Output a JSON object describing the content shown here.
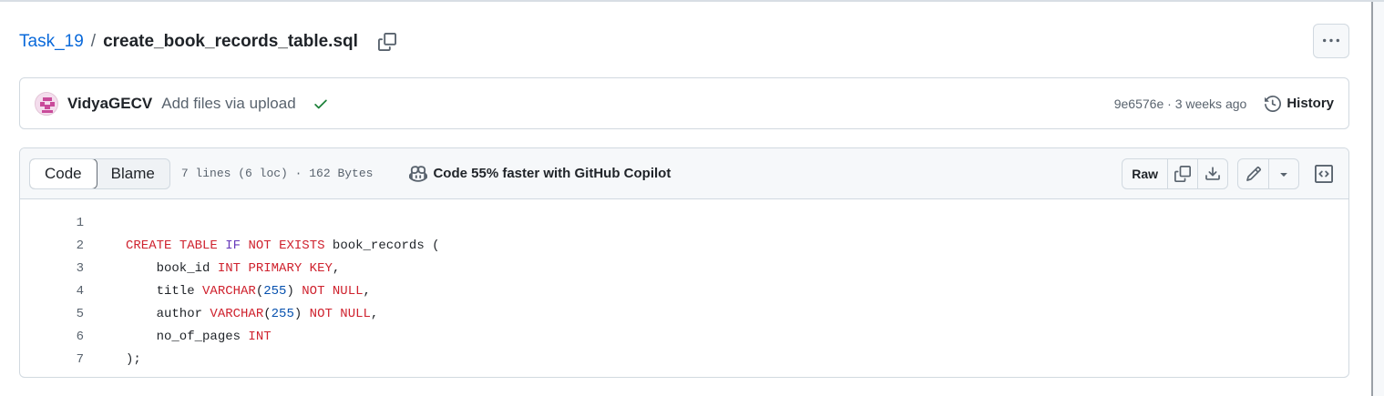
{
  "breadcrumb": {
    "repo": "Task_19",
    "separator": "/",
    "file": "create_book_records_table.sql"
  },
  "commit": {
    "author": "VidyaGECV",
    "message": "Add files via upload",
    "sha": "9e6576e",
    "dot": "·",
    "time": "3 weeks ago",
    "history_label": "History"
  },
  "file": {
    "tabs": [
      "Code",
      "Blame"
    ],
    "active_tab": "Code",
    "meta": "7 lines (6 loc) · 162 Bytes",
    "copilot_text": "Code 55% faster with GitHub Copilot",
    "raw_label": "Raw"
  },
  "code_lines": [
    {
      "n": "1",
      "text": ""
    },
    {
      "n": "2",
      "text": "CREATE TABLE IF NOT EXISTS book_records ("
    },
    {
      "n": "3",
      "text": "    book_id INT PRIMARY KEY,"
    },
    {
      "n": "4",
      "text": "    title VARCHAR(255) NOT NULL,"
    },
    {
      "n": "5",
      "text": "    author VARCHAR(255) NOT NULL,"
    },
    {
      "n": "6",
      "text": "    no_of_pages INT"
    },
    {
      "n": "7",
      "text": ");"
    }
  ],
  "colors": {
    "link": "#0969da",
    "keyword": "#cf222e",
    "number": "#0550ae",
    "success": "#1a7f37"
  },
  "icons": [
    "copy-icon",
    "kebab-icon",
    "check-icon",
    "history-icon",
    "copilot-icon",
    "download-icon",
    "pencil-icon",
    "triangle-down-icon",
    "symbols-icon"
  ]
}
